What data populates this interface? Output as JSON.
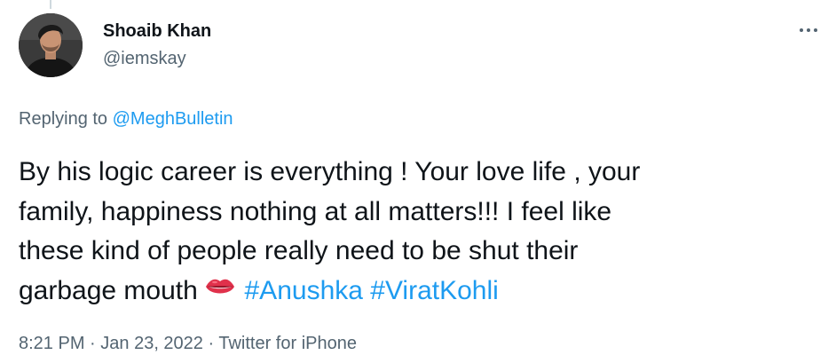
{
  "author": {
    "display_name": "Shoaib Khan",
    "handle": "@iemskay"
  },
  "reply": {
    "prefix": "Replying to ",
    "mention": "@MeghBulletin"
  },
  "tweet": {
    "line1": "By his logic career is everything ! Your love life , your",
    "line2": "family, happiness nothing at all matters!!! I feel like",
    "line3": "these kind of people really need to be shut their",
    "line4_text": "garbage mouth ",
    "emoji": "lips-emoji",
    "hashtags": [
      "#Anushka",
      "#ViratKohli"
    ]
  },
  "meta": {
    "time": "8:21 PM",
    "separator": " · ",
    "date": "Jan 23, 2022",
    "source": "Twitter for iPhone"
  },
  "icons": {
    "more": "more-horizontal-icon"
  },
  "colors": {
    "link": "#1d9bf0",
    "secondary": "#536471",
    "text": "#0f1419"
  }
}
